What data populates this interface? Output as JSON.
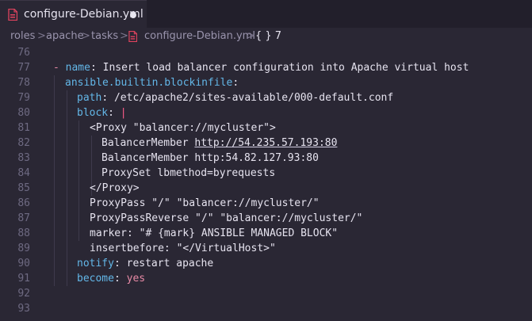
{
  "tab": {
    "filename": "configure-Debian.yml"
  },
  "breadcrumb": {
    "roles": "roles",
    "apache": "apache",
    "tasks": "tasks",
    "file": "configure-Debian.yml",
    "symbol": "{ } 7",
    "sep": ">"
  },
  "editor": {
    "lines": [
      {
        "n": "76"
      },
      {
        "n": "77",
        "dash": "- ",
        "key": "name",
        "colon": ": ",
        "val": "Insert load balancer configuration into Apache virtual host"
      },
      {
        "n": "78",
        "key": "ansible.builtin.blockinfile",
        "colon": ":"
      },
      {
        "n": "79",
        "key": "path",
        "colon": ": ",
        "val": "/etc/apache2/sites-available/000-default.conf"
      },
      {
        "n": "80",
        "key": "block",
        "colon": ": ",
        "pipe": "|"
      },
      {
        "n": "81",
        "text": "<Proxy \"balancer://mycluster\">"
      },
      {
        "n": "82",
        "text_a": "BalancerMember ",
        "text_u": "http://54.235.57.193:80"
      },
      {
        "n": "83",
        "text": "BalancerMember http:54.82.127.93:80"
      },
      {
        "n": "84",
        "text": "ProxySet lbmethod=byrequests"
      },
      {
        "n": "85",
        "text": "</Proxy>"
      },
      {
        "n": "86",
        "text": "ProxyPass \"/\" \"balancer://mycluster/\""
      },
      {
        "n": "87",
        "text": "ProxyPassReverse \"/\" \"balancer://mycluster/\""
      },
      {
        "n": "88",
        "text": "marker: \"# {mark} ANSIBLE MANAGED BLOCK\""
      },
      {
        "n": "89",
        "text": "insertbefore: \"</VirtualHost>\""
      },
      {
        "n": "90",
        "key": "notify",
        "colon": ": ",
        "val": "restart apache"
      },
      {
        "n": "91",
        "key": "become",
        "colon": ": ",
        "pval": "yes"
      },
      {
        "n": "92"
      },
      {
        "n": "93"
      }
    ]
  },
  "colors": {
    "background": "#2a2734",
    "key": "#63b7e8",
    "text": "#e6e3ef",
    "yaml_icon": "#e0435e"
  }
}
